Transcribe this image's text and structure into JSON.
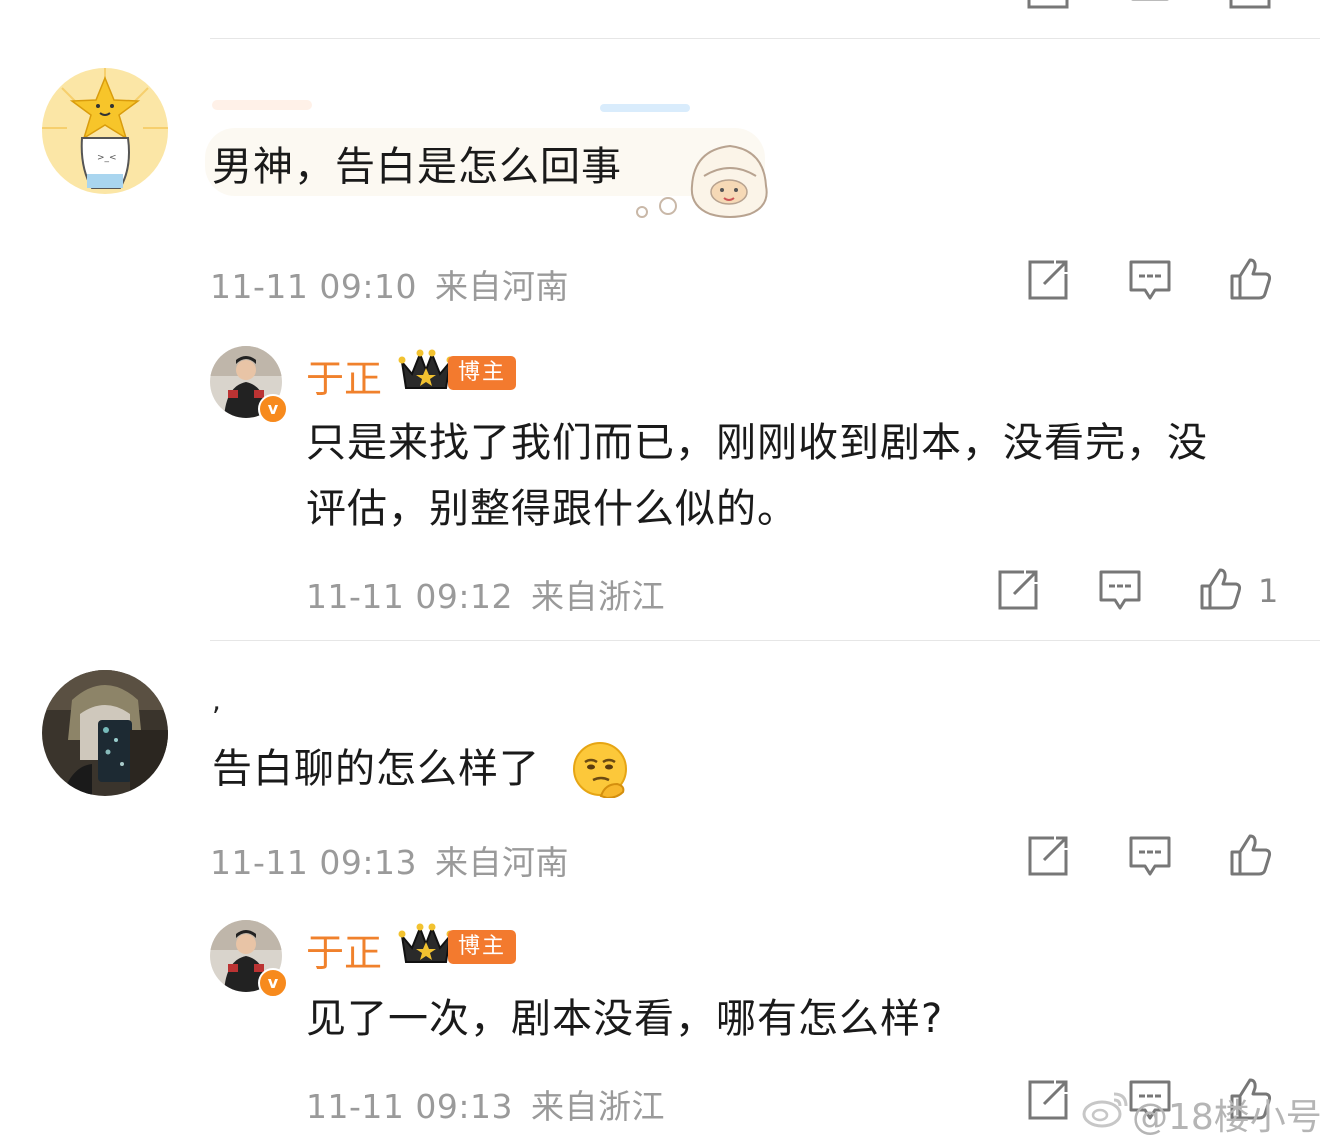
{
  "comments": [
    {
      "text": "男神，告白是怎么回事",
      "time": "11-11 09:10",
      "location": "来自河南",
      "reply": {
        "author": "于正",
        "badge": "博主",
        "verified_mark": "v",
        "text": "只是来找了我们而已，刚刚收到剧本，没看完，没评估，别整得跟什么似的。",
        "time": "11-11 09:12",
        "location": "来自浙江",
        "likes": "1"
      }
    },
    {
      "username_fragment": ",",
      "text": "告白聊的怎么样了",
      "time": "11-11 09:13",
      "location": "来自河南",
      "reply": {
        "author": "于正",
        "badge": "博主",
        "verified_mark": "v",
        "text": "见了一次，剧本没看，哪有怎么样?",
        "time": "11-11 09:13",
        "location": "来自浙江"
      }
    }
  ],
  "watermark": "@18楼小号",
  "colors": {
    "author_name": "#f0812c",
    "badge_bg": "#f37a2e",
    "meta_text": "#9a9a9a",
    "icon": "#777777"
  },
  "icons": [
    "share-icon",
    "comment-icon",
    "like-icon",
    "crown-icon",
    "weibo-logo-icon"
  ]
}
